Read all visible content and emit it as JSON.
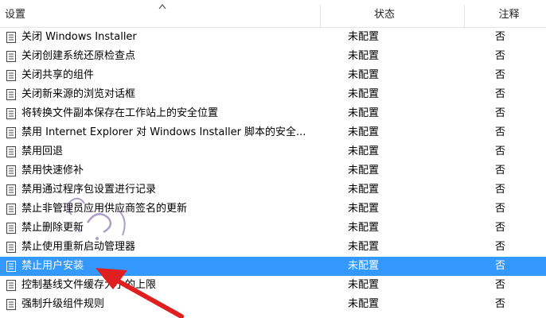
{
  "header": {
    "name_label": "设置",
    "status_label": "状态",
    "note_label": "注释"
  },
  "rows": [
    {
      "name": "关闭 Windows Installer",
      "status": "未配置",
      "note": "否"
    },
    {
      "name": "关闭创建系统还原检查点",
      "status": "未配置",
      "note": "否"
    },
    {
      "name": "关闭共享的组件",
      "status": "未配置",
      "note": "否"
    },
    {
      "name": "关闭新来源的浏览对话框",
      "status": "未配置",
      "note": "否"
    },
    {
      "name": "将转换文件副本保存在工作站上的安全位置",
      "status": "未配置",
      "note": "否"
    },
    {
      "name": "禁用 Internet Explorer 对 Windows Installer 脚本的安全...",
      "status": "未配置",
      "note": "否"
    },
    {
      "name": "禁用回退",
      "status": "未配置",
      "note": "否"
    },
    {
      "name": "禁用快速修补",
      "status": "未配置",
      "note": "否"
    },
    {
      "name": "禁用通过程序包设置进行记录",
      "status": "未配置",
      "note": "否"
    },
    {
      "name": "禁止非管理员应用供应商签名的更新",
      "status": "未配置",
      "note": "否"
    },
    {
      "name": "禁止删除更新",
      "status": "未配置",
      "note": "否"
    },
    {
      "name": "禁止使用重新启动管理器",
      "status": "未配置",
      "note": "否"
    },
    {
      "name": "禁止用户安装",
      "status": "未配置",
      "note": "否"
    },
    {
      "name": "控制基线文件缓存大小的上限",
      "status": "未配置",
      "note": "否"
    },
    {
      "name": "强制升级组件规则",
      "status": "未配置",
      "note": "否"
    }
  ],
  "selected_index": 12,
  "colors": {
    "selection": "#3399ff",
    "arrow": "#e02020"
  },
  "icons": {
    "row_icon": "policy-setting-icon",
    "sort_icon": "sort-ascending-icon"
  }
}
